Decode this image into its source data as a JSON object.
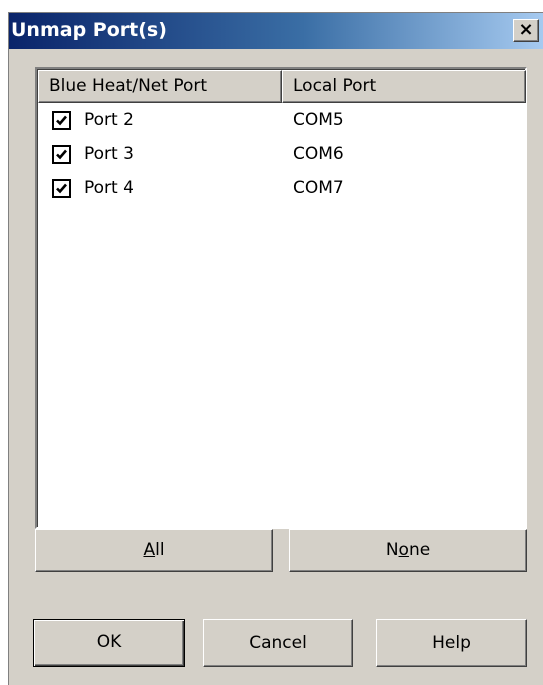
{
  "window": {
    "title": "Unmap Port(s)",
    "close_glyph": "×"
  },
  "list": {
    "columns": [
      "Blue Heat/Net Port",
      "Local Port"
    ],
    "rows": [
      {
        "port": "Port 2",
        "local": "COM5",
        "checked": true
      },
      {
        "port": "Port 3",
        "local": "COM6",
        "checked": true
      },
      {
        "port": "Port 4",
        "local": "COM7",
        "checked": true
      }
    ]
  },
  "select_buttons": {
    "all_label": "All",
    "all_mnemonic": "A",
    "none_label": "None",
    "none_mnemonic": "o"
  },
  "dialog_buttons": {
    "ok_label": "OK",
    "cancel_label": "Cancel",
    "help_label": "Help"
  },
  "colors": {
    "dialog_face": "#d4d0c8",
    "titlebar_start": "#0a246a",
    "titlebar_end": "#a6caf0",
    "list_background": "#ffffff"
  }
}
